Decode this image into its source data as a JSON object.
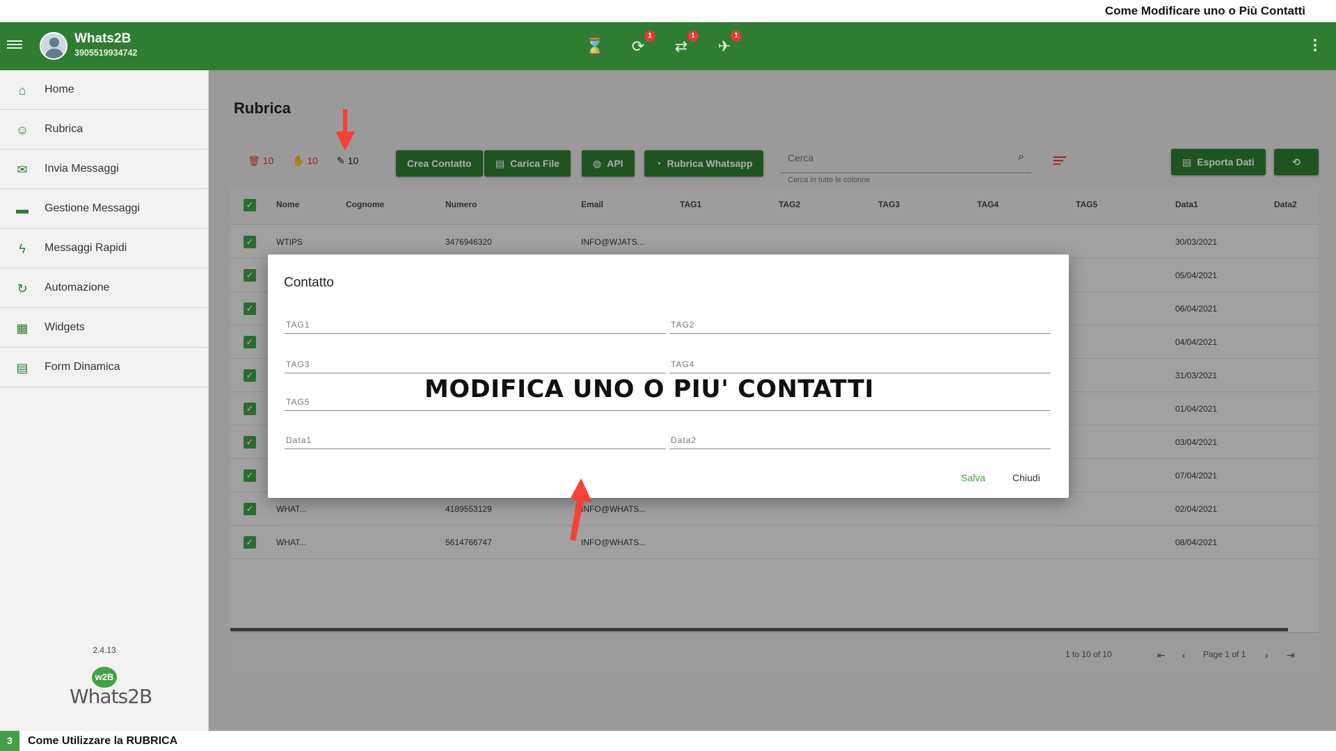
{
  "caption": {
    "top": "Come Modificare uno o Più Contatti",
    "bottom_number": "3",
    "bottom": "Come Utilizzare la RUBRICA"
  },
  "appbar": {
    "title": "Whats2B",
    "subtitle": "3905519934742",
    "icons": [
      {
        "name": "hourglass-icon",
        "glyph": "⌛",
        "badge": ""
      },
      {
        "name": "timer-icon",
        "glyph": "⟳",
        "badge": "1"
      },
      {
        "name": "sync-icon",
        "glyph": "⇄",
        "badge": "1"
      },
      {
        "name": "scooter-icon",
        "glyph": "✈",
        "badge": "1"
      }
    ]
  },
  "sidebar": {
    "items": [
      {
        "label": "Home",
        "icon": "home-icon",
        "glyph": "⌂"
      },
      {
        "label": "Rubrica",
        "icon": "contacts-icon",
        "glyph": "☺"
      },
      {
        "label": "Invia Messaggi",
        "icon": "mail-icon",
        "glyph": "✉"
      },
      {
        "label": "Gestione Messaggi",
        "icon": "folder-icon",
        "glyph": "▬"
      },
      {
        "label": "Messaggi Rapidi",
        "icon": "lightning-icon",
        "glyph": "ϟ"
      },
      {
        "label": "Automazione",
        "icon": "refresh-icon",
        "glyph": "↻"
      },
      {
        "label": "Widgets",
        "icon": "widgets-icon",
        "glyph": "▦"
      },
      {
        "label": "Form Dinamica",
        "icon": "form-icon",
        "glyph": "▤"
      }
    ],
    "logo_circle": "w2B",
    "logo_word": "Whats2B",
    "version": "2.4.13"
  },
  "main": {
    "title": "Rubrica",
    "counters": {
      "delete": "10",
      "block": "10",
      "edit": "10"
    },
    "buttons": {
      "create": "Crea Contatto",
      "upload": "Carica File",
      "api": "API",
      "whatsapp": "Rubrica Whatsapp",
      "export": "Esporta Dati"
    },
    "search": {
      "placeholder": "Cerca",
      "help": "Cerca in tutte le colonne"
    },
    "columns": [
      "Nome",
      "Cognome",
      "Numero",
      "Email",
      "TAG1",
      "TAG2",
      "TAG3",
      "TAG4",
      "TAG5",
      "Data1",
      "Data2"
    ],
    "rows": [
      {
        "nome": "WTIPS",
        "numero": "3476946320",
        "email": "INFO@WJATS...",
        "data1": "30/03/2021"
      },
      {
        "nome": "",
        "numero": "",
        "email": "",
        "data1": "05/04/2021"
      },
      {
        "nome": "",
        "numero": "",
        "email": "",
        "data1": "06/04/2021"
      },
      {
        "nome": "",
        "numero": "",
        "email": "",
        "data1": "04/04/2021"
      },
      {
        "nome": "",
        "numero": "",
        "email": "",
        "data1": "31/03/2021"
      },
      {
        "nome": "",
        "numero": "",
        "email": "",
        "data1": "01/04/2021"
      },
      {
        "nome": "",
        "numero": "",
        "email": "",
        "data1": "03/04/2021"
      },
      {
        "nome": "",
        "numero": "",
        "email": "",
        "data1": "07/04/2021"
      },
      {
        "nome": "WHAT...",
        "numero": "4189553129",
        "email": "INFO@WHATS...",
        "data1": "02/04/2021"
      },
      {
        "nome": "WHAT...",
        "numero": "5614766747",
        "email": "INFO@WHATS...",
        "data1": "08/04/2021"
      }
    ],
    "footer": {
      "range": "1 to 10 of 10",
      "page": "Page 1 of 1"
    }
  },
  "dialog": {
    "title": "Contatto",
    "fields": {
      "tag1": "TAG1",
      "tag2": "TAG2",
      "tag3": "TAG3",
      "tag4": "TAG4",
      "tag5": "TAG5",
      "data1": "Data1",
      "data2": "Data2"
    },
    "overlay_text": "MODIFICA UNO O PIU' CONTATTI",
    "save": "Salva",
    "close": "Chiudi"
  },
  "colors": {
    "brand": "#2e7d32",
    "accent": "#43a047",
    "danger": "#e53935",
    "arrow": "#f44336"
  }
}
